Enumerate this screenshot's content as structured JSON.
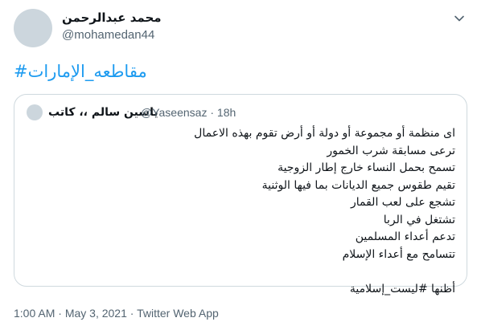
{
  "tweet": {
    "author_name": "محمد عبدالرحمن",
    "author_handle": "@mohamedan44",
    "hashtag": "#مقاطعه_الإمارات"
  },
  "quoted_tweet": {
    "author_name": "ياسين سالم ،، كاتب",
    "author_handle": "@Yaseensaz",
    "time": "18h",
    "lines": [
      "اى منظمة أو مجموعة أو دولة أو أرض تقوم بهذه الاعمال",
      "ترعى مسابقة شرب الخمور",
      "تسمح بحمل النساء خارج إطار الزوجية",
      "تقيم طقوس جميع الديانات بما فيها الوثنية",
      "تشجع على لعب القمار",
      "تشتغل في الربا",
      "تدعم أعداء المسلمين",
      "تتسامح مع أعداء الإسلام",
      "",
      "أظنها #ليست_إسلامية"
    ]
  },
  "meta": {
    "time": "1:00 AM",
    "date": "May 3, 2021",
    "source": "Twitter Web App",
    "separator": "·"
  },
  "icons": {
    "more": "chevron-down-icon"
  }
}
